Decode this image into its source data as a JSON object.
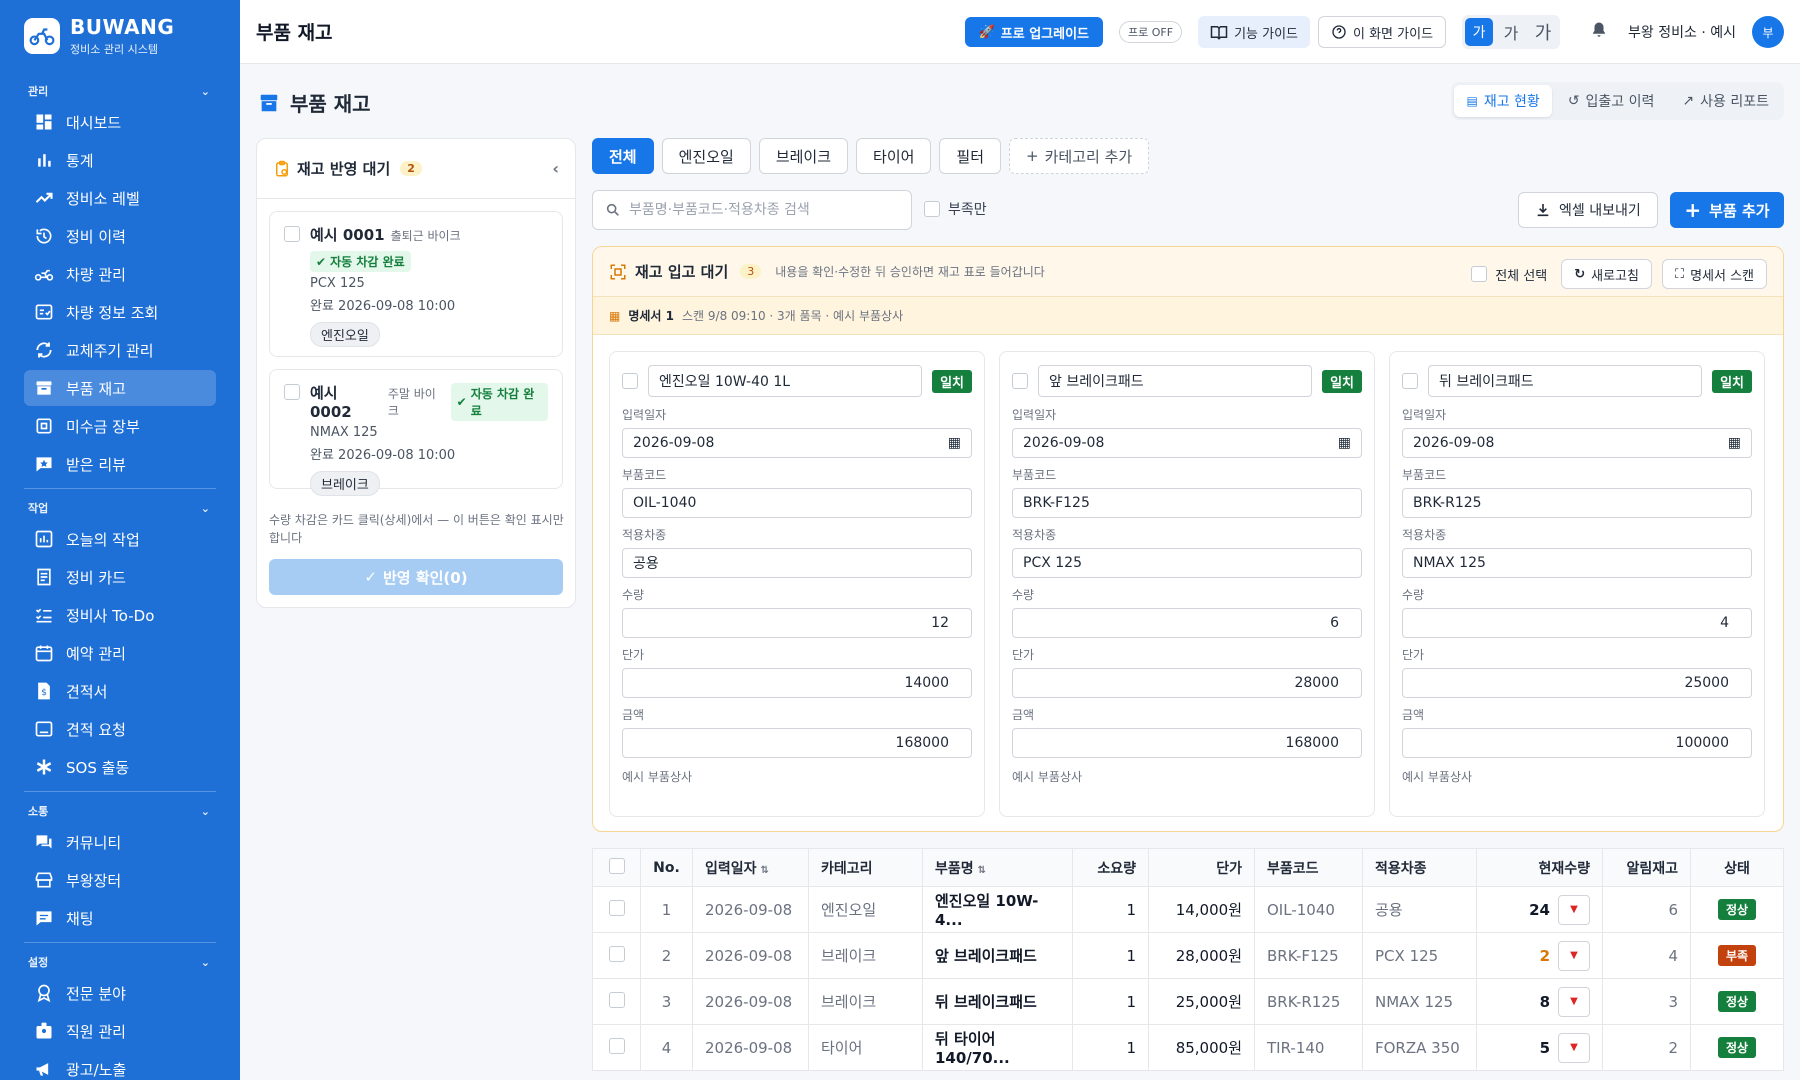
{
  "brand": {
    "name": "BUWANG",
    "subtitle": "정비소 관리 시스템"
  },
  "sidebar": {
    "sections": [
      {
        "label": "관리",
        "items": [
          "대시보드",
          "통계",
          "정비소 레벨",
          "정비 이력",
          "차량 관리",
          "차량 정보 조회",
          "교체주기 관리",
          "부품 재고",
          "미수금 장부",
          "받은 리뷰"
        ]
      },
      {
        "label": "작업",
        "items": [
          "오늘의 작업",
          "정비 카드",
          "정비사 To-Do",
          "예약 관리",
          "견적서",
          "견적 요청",
          "SOS 출동"
        ]
      },
      {
        "label": "소통",
        "items": [
          "커뮤니티",
          "부왕장터",
          "채팅"
        ]
      },
      {
        "label": "설정",
        "items": [
          "전문 분야",
          "직원 관리",
          "광고/노출"
        ]
      }
    ],
    "active": "부품 재고"
  },
  "topbar": {
    "title": "부품 재고",
    "pro_upgrade": "프로 업그레이드",
    "pro_status": "프로 OFF",
    "feature_guide": "기능 가이드",
    "screen_guide": "이 화면 가이드",
    "font_sizes": [
      "가",
      "가",
      "가"
    ],
    "user": "부왕 정비소 · 예시",
    "avatar": "부"
  },
  "page": {
    "title": "부품 재고",
    "views": [
      "재고 현황",
      "입출고 이력",
      "사용 리포트"
    ],
    "active_view": "재고 현황"
  },
  "pending": {
    "title": "재고 반영 대기",
    "count": "2",
    "cards": [
      {
        "id": "예시 0001",
        "type": "출퇴근 바이크",
        "badge": "자동 차감 완료",
        "model": "PCX 125",
        "done": "완료 2026-09-08 10:00",
        "tag": "엔진오일"
      },
      {
        "id": "예시 0002",
        "type": "주말 바이크",
        "badge": "자동 차감 완료",
        "model": "NMAX 125",
        "done": "완료 2026-09-08 10:00",
        "tag": "브레이크"
      }
    ],
    "note": "수량 차감은 카드 클릭(상세)에서 — 이 버튼은 확인 표시만 합니다",
    "confirm": "반영 확인(0)"
  },
  "categories": [
    "전체",
    "엔진오일",
    "브레이크",
    "타이어",
    "필터"
  ],
  "add_category": "카테고리 추가",
  "search": {
    "placeholder": "부품명·부품코드·적용차종 검색",
    "shortage_only": "부족만"
  },
  "actions": {
    "excel": "엑셀 내보내기",
    "add_part": "부품 추가"
  },
  "intake": {
    "title": "재고 입고 대기",
    "count": "3",
    "desc": "내용을 확인·수정한 뒤 승인하면 재고 표로 들어갑니다",
    "select_all": "전체 선택",
    "refresh": "새로고침",
    "scan": "명세서 스캔",
    "invoice_label": "명세서 1",
    "invoice_meta": "스캔 9/8 09:10 · 3개 품목 · 예시 부품상사",
    "field_labels": {
      "date": "입력일자",
      "code": "부품코드",
      "model": "적용차종",
      "qty": "수량",
      "price": "단가",
      "amount": "금액"
    },
    "items": [
      {
        "name": "엔진오일 10W-40 1L",
        "match": "일치",
        "date": "2026-09-08",
        "code": "OIL-1040",
        "model": "공용",
        "qty": "12",
        "price": "14000",
        "amount": "168000",
        "vendor": "예시 부품상사"
      },
      {
        "name": "앞 브레이크패드",
        "match": "일치",
        "date": "2026-09-08",
        "code": "BRK-F125",
        "model": "PCX 125",
        "qty": "6",
        "price": "28000",
        "amount": "168000",
        "vendor": "예시 부품상사"
      },
      {
        "name": "뒤 브레이크패드",
        "match": "일치",
        "date": "2026-09-08",
        "code": "BRK-R125",
        "model": "NMAX 125",
        "qty": "4",
        "price": "25000",
        "amount": "100000",
        "vendor": "예시 부품상사"
      }
    ]
  },
  "table": {
    "headers": [
      "No.",
      "입력일자",
      "카테고리",
      "부품명",
      "소요량",
      "단가",
      "부품코드",
      "적용차종",
      "현재수량",
      "알림재고",
      "상태"
    ],
    "rows": [
      {
        "no": "1",
        "date": "2026-09-08",
        "cat": "엔진오일",
        "name": "엔진오일 10W-4...",
        "use": "1",
        "price": "14,000원",
        "code": "OIL-1040",
        "model": "공용",
        "qty": "24",
        "alert": "6",
        "status": "정상"
      },
      {
        "no": "2",
        "date": "2026-09-08",
        "cat": "브레이크",
        "name": "앞 브레이크패드",
        "use": "1",
        "price": "28,000원",
        "code": "BRK-F125",
        "model": "PCX 125",
        "qty": "2",
        "alert": "4",
        "status": "부족"
      },
      {
        "no": "3",
        "date": "2026-09-08",
        "cat": "브레이크",
        "name": "뒤 브레이크패드",
        "use": "1",
        "price": "25,000원",
        "code": "BRK-R125",
        "model": "NMAX 125",
        "qty": "8",
        "alert": "3",
        "status": "정상"
      },
      {
        "no": "4",
        "date": "2026-09-08",
        "cat": "타이어",
        "name": "뒤 타이어 140/70...",
        "use": "1",
        "price": "85,000원",
        "code": "TIR-140",
        "model": "FORZA 350",
        "qty": "5",
        "alert": "2",
        "status": "정상"
      }
    ]
  },
  "colors": {
    "primary": "#1877e8",
    "sidebar": "#1e6fd6",
    "ok": "#15803d",
    "shortage": "#c2410c",
    "warn": "#d97706"
  }
}
